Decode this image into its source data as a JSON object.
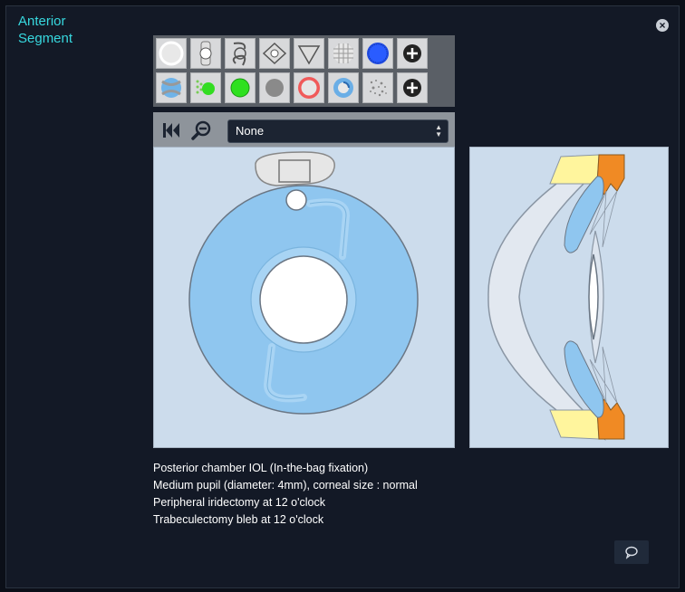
{
  "panel": {
    "title": "Anterior Segment",
    "close_icon": "close-icon"
  },
  "toolbar": {
    "row1": [
      "cornea-circle-icon",
      "iol-optic-icon",
      "iol-haptic-icon",
      "iol-diamond-icon",
      "iol-triangle-icon",
      "mesh-pattern-icon",
      "blue-dots-icon",
      "add-icon"
    ],
    "row2": [
      "pupil-hourglass-icon",
      "green-dot-pattern-icon",
      "green-circle-icon",
      "gray-circle-icon",
      "red-ring-icon",
      "blue-swirl-icon",
      "scatter-icon",
      "add-icon"
    ]
  },
  "viewer": {
    "first_icon": "skip-first-icon",
    "zoom_icon": "zoom-out-icon",
    "select_value": "None"
  },
  "notes": [
    "Posterior chamber IOL (In-the-bag fixation)",
    "Medium pupil (diameter: 4mm), corneal size : normal",
    "Peripheral iridectomy at 12 o'clock",
    "Trabeculectomy bleb at 12 o'clock"
  ],
  "colors": {
    "accent": "#37d8df",
    "iris_blue": "#8fc6ef",
    "canvas_bg": "#ccdcec",
    "angle_yellow": "#fff59d",
    "angle_orange": "#f08a24"
  }
}
